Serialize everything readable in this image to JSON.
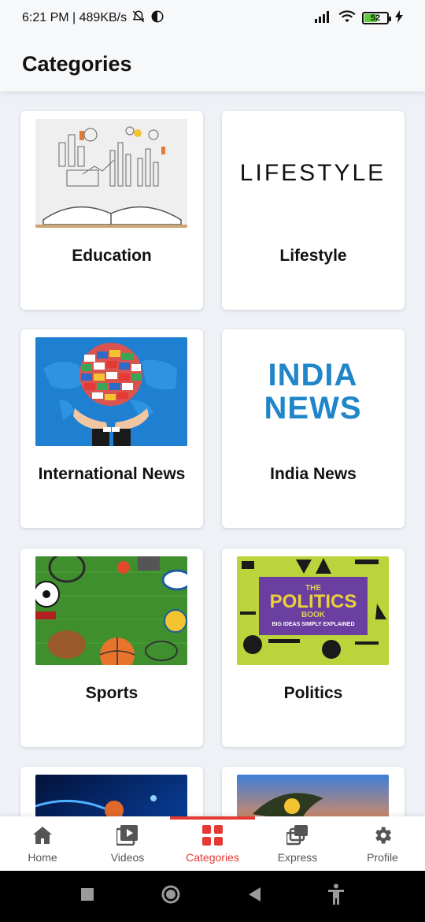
{
  "status_bar": {
    "time_speed": "6:21 PM | 489KB/s",
    "battery_level": "52"
  },
  "header": {
    "title": "Categories"
  },
  "categories": [
    {
      "label": "Education",
      "thumb_text": ""
    },
    {
      "label": "Lifestyle",
      "thumb_text": "LIFESTYLE"
    },
    {
      "label": "International News",
      "thumb_text": ""
    },
    {
      "label": "India News",
      "thumb_text_line1": "INDIA",
      "thumb_text_line2": "NEWS"
    },
    {
      "label": "Sports",
      "thumb_text": ""
    },
    {
      "label": "Politics",
      "thumb_text_line1": "THE",
      "thumb_text_line2": "POLITICS",
      "thumb_text_line3": "BOOK",
      "thumb_text_line4": "BIG IDEAS SIMPLY EXPLAINED"
    }
  ],
  "bottom_nav": {
    "items": [
      {
        "label": "Home",
        "icon": "home-icon"
      },
      {
        "label": "Videos",
        "icon": "video-icon"
      },
      {
        "label": "Categories",
        "icon": "grid-icon",
        "active": true
      },
      {
        "label": "Express",
        "icon": "stack-icon"
      },
      {
        "label": "Profile",
        "icon": "gear-icon"
      }
    ]
  },
  "colors": {
    "accent": "#e53935",
    "background": "#eef2f7"
  }
}
